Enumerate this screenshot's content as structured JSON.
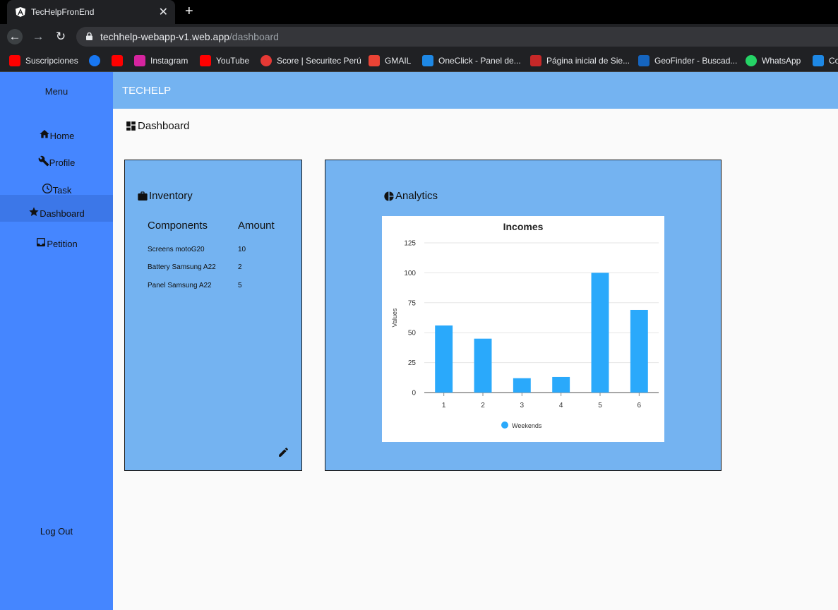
{
  "browser": {
    "tab_title": "TecHelpFronEnd",
    "url_host": "techhelp-webapp-v1.web.app",
    "url_path": "/dashboard",
    "bookmarks": [
      {
        "label": "Suscripciones",
        "icon": "youtube-icon",
        "color": "#ff0000"
      },
      {
        "label": "",
        "icon": "facebook-icon",
        "color": "#1877f2"
      },
      {
        "label": "",
        "icon": "youtube-icon",
        "color": "#ff0000"
      },
      {
        "label": "Instagram",
        "icon": "instagram-icon",
        "color": "#d6249f"
      },
      {
        "label": "YouTube",
        "icon": "youtube-icon",
        "color": "#ff0000"
      },
      {
        "label": "Score | Securitec Perú",
        "icon": "score-icon",
        "color": "#e53935"
      },
      {
        "label": "GMAIL",
        "icon": "gmail-icon",
        "color": "#ea4335"
      },
      {
        "label": "OneClick - Panel de...",
        "icon": "edge-icon",
        "color": "#1e88e5"
      },
      {
        "label": "Página inicial de Sie...",
        "icon": "globe-icon",
        "color": "#c62828"
      },
      {
        "label": "GeoFinder - Buscad...",
        "icon": "map-pin-icon",
        "color": "#1565c0"
      },
      {
        "label": "WhatsApp",
        "icon": "whatsapp-icon",
        "color": "#25d366"
      },
      {
        "label": "Co",
        "icon": "edge-icon",
        "color": "#1e88e5"
      }
    ]
  },
  "sidebar": {
    "title": "Menu",
    "items": [
      {
        "label": "Home",
        "icon": "home-icon"
      },
      {
        "label": "Profile",
        "icon": "wrench-icon"
      },
      {
        "label": "Task",
        "icon": "clock-icon"
      },
      {
        "label": "Dashboard",
        "icon": "star-icon",
        "active": true
      },
      {
        "label": "Petition",
        "icon": "inbox-icon"
      }
    ],
    "logout": "Log Out"
  },
  "header": {
    "brand": "TECHELP"
  },
  "page": {
    "title": "Dashboard"
  },
  "inventory": {
    "title": "Inventory",
    "headers": [
      "Components",
      "Amount"
    ],
    "rows": [
      {
        "component": "Screens motoG20",
        "amount": "10"
      },
      {
        "component": "Battery Samsung A22",
        "amount": "2"
      },
      {
        "component": "Panel Samsung A22",
        "amount": "5"
      }
    ]
  },
  "analytics": {
    "title": "Analytics"
  },
  "chart_data": {
    "type": "bar",
    "title": "Incomes",
    "xlabel": "",
    "ylabel": "Values",
    "categories": [
      "1",
      "2",
      "3",
      "4",
      "5",
      "6"
    ],
    "series": [
      {
        "name": "Weekends",
        "values": [
          56,
          45,
          12,
          13,
          100,
          69
        ]
      }
    ],
    "ylim": [
      0,
      125
    ],
    "yticks": [
      0,
      25,
      50,
      75,
      100,
      125
    ],
    "grid": true,
    "legend": "bottom",
    "bar_color": "#2aa9fb"
  }
}
